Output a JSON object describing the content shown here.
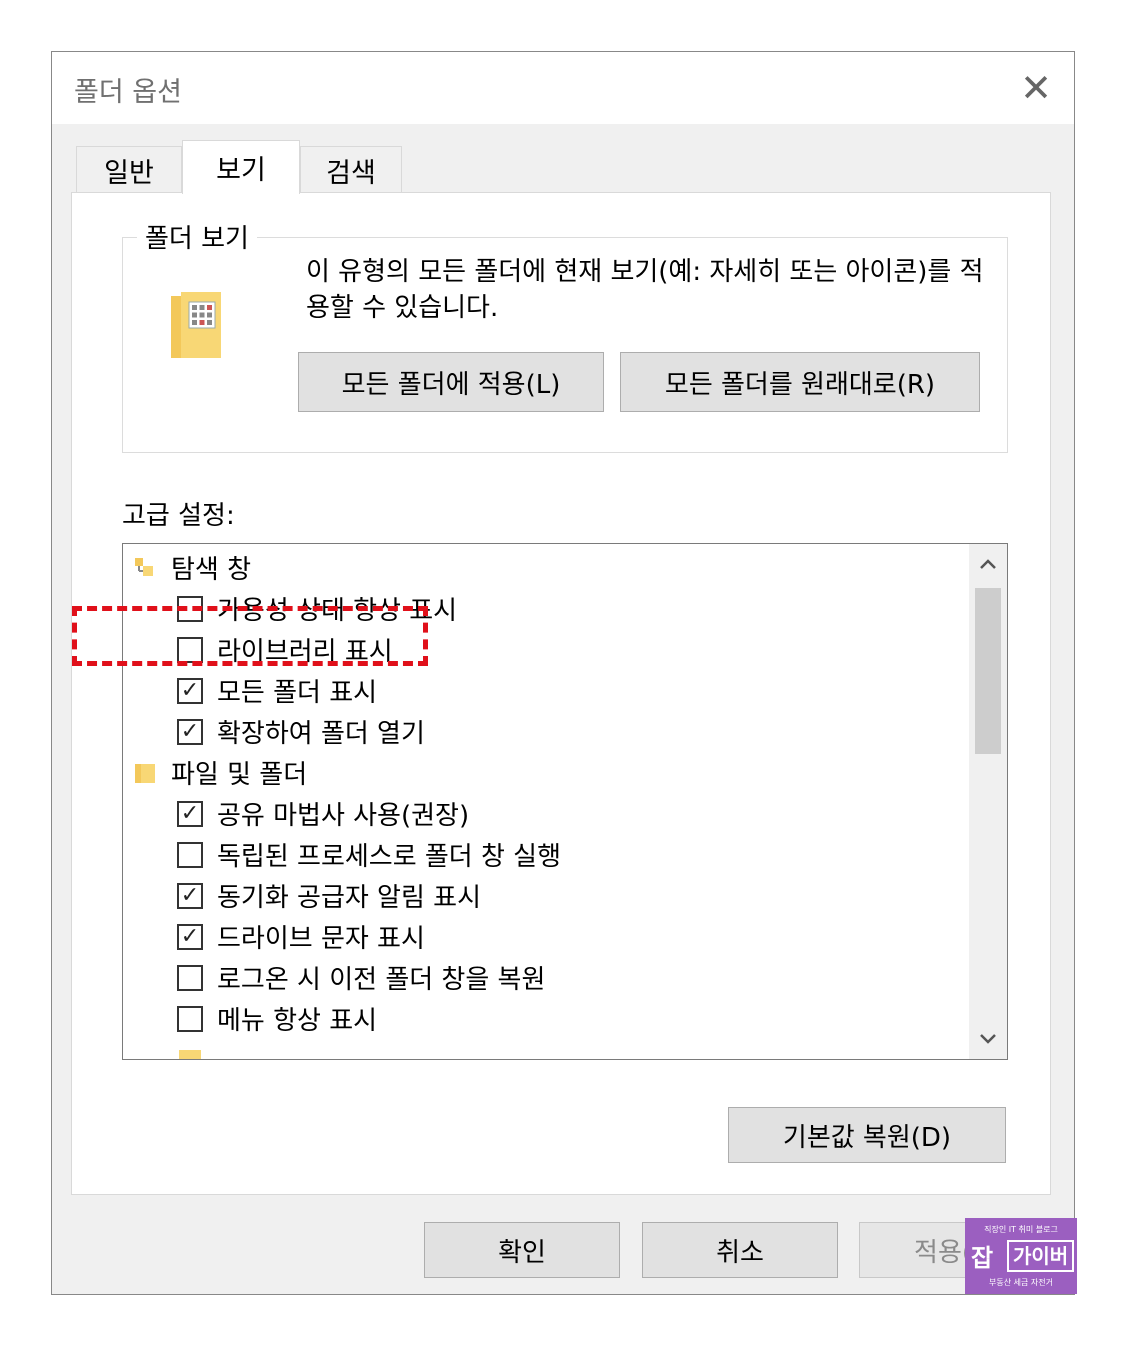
{
  "dialog": {
    "title": "폴더 옵션",
    "close_glyph": "✕"
  },
  "tabs": [
    {
      "label": "일반",
      "active": false
    },
    {
      "label": "보기",
      "active": true
    },
    {
      "label": "검색",
      "active": false
    }
  ],
  "folder_view": {
    "legend": "폴더 보기",
    "description": "이 유형의 모든 폴더에 현재 보기(예: 자세히 또는 아이콘)를 적용할 수 있습니다.",
    "apply_button": "모든 폴더에 적용(L)",
    "reset_button": "모든 폴더를 원래대로(R)"
  },
  "advanced": {
    "label": "고급 설정:",
    "items": [
      {
        "type": "group",
        "icon": "nav-pane-icon",
        "label": "탐색 창"
      },
      {
        "type": "checkbox",
        "checked": false,
        "label": "가용성 상태 항상 표시"
      },
      {
        "type": "checkbox",
        "checked": false,
        "label": "라이브러리 표시"
      },
      {
        "type": "checkbox",
        "checked": true,
        "label": "모든 폴더 표시"
      },
      {
        "type": "checkbox",
        "checked": true,
        "label": "확장하여 폴더 열기"
      },
      {
        "type": "group",
        "icon": "folder-icon",
        "label": "파일 및 폴더"
      },
      {
        "type": "checkbox",
        "checked": true,
        "label": "공유 마법사 사용(권장)"
      },
      {
        "type": "checkbox",
        "checked": false,
        "label": "독립된 프로세스로 폴더 창 실행"
      },
      {
        "type": "checkbox",
        "checked": true,
        "label": "동기화 공급자 알림 표시"
      },
      {
        "type": "checkbox",
        "checked": true,
        "label": "드라이브 문자 표시"
      },
      {
        "type": "checkbox",
        "checked": false,
        "label": "로그온 시 이전 폴더 창을 복원"
      },
      {
        "type": "checkbox",
        "checked": false,
        "label": "메뉴 항상 표시"
      }
    ],
    "restore_button": "기본값 복원(D)"
  },
  "footer": {
    "ok": "확인",
    "cancel": "취소",
    "apply": "적용(A)"
  },
  "watermark": {
    "top": "직장인 IT 취미 블로그",
    "mark": "잡",
    "name": "가이버",
    "bottom": "부동산 세금 자전거"
  },
  "colors": {
    "highlight": "#e0101a",
    "watermark": "#9b5fc0",
    "folder": "#f8d775"
  }
}
